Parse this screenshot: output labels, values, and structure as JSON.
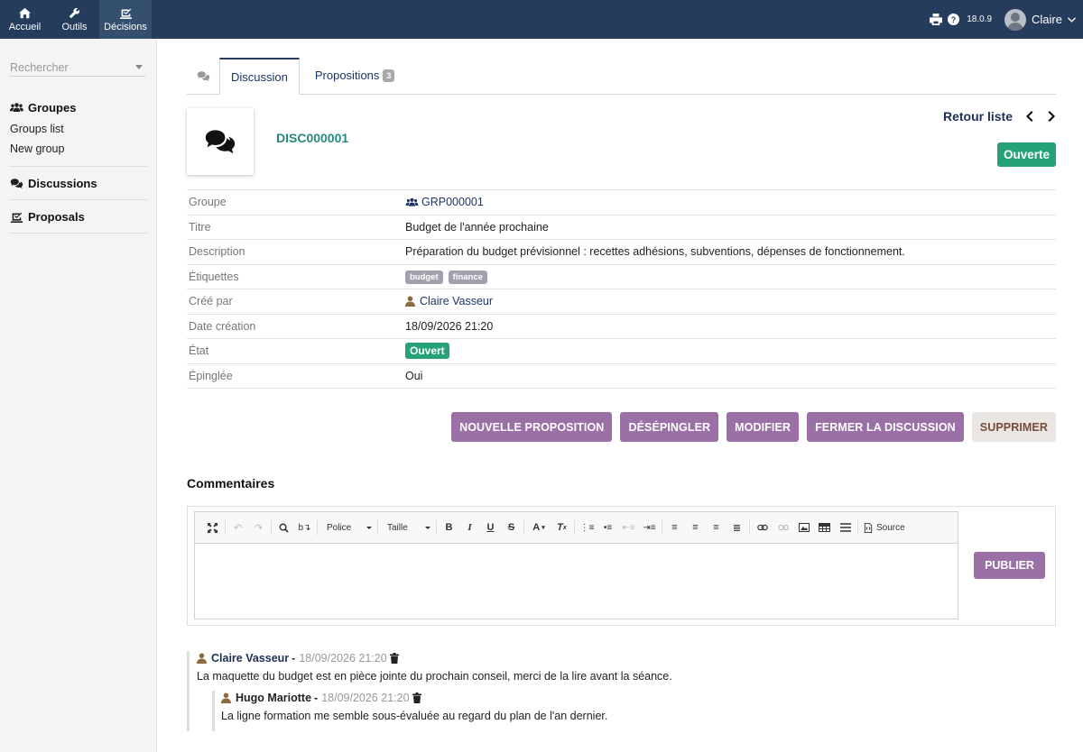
{
  "topbar": {
    "nav": [
      {
        "label": "Accueil",
        "icon": "home-icon"
      },
      {
        "label": "Outils",
        "icon": "wrench-icon"
      },
      {
        "label": "Décisions",
        "icon": "decisions-icon"
      }
    ],
    "version": "18.0.9",
    "user_name": "Claire"
  },
  "sidebar": {
    "search_placeholder": "Rechercher",
    "groups_heading": "Groupes",
    "groups_items": [
      "Groups list",
      "New group"
    ],
    "discussions_heading": "Discussions",
    "proposals_heading": "Proposals"
  },
  "tabs": {
    "discussion_label": "Discussion",
    "propositions_label": "Propositions",
    "propositions_count": "3"
  },
  "record": {
    "ref": "DISC000001",
    "back_label": "Retour liste",
    "status_button": "Ouverte"
  },
  "fields": {
    "groupe_label": "Groupe",
    "groupe_value": "GRP000001",
    "titre_label": "Titre",
    "titre_value": "Budget de l'année prochaine",
    "description_label": "Description",
    "description_value": "Préparation du budget prévisionnel : recettes adhésions, subventions, dépenses de fonctionnement.",
    "etiquettes_label": "Étiquettes",
    "tags": [
      "budget",
      "finance"
    ],
    "cree_par_label": "Créé par",
    "cree_par_value": "Claire Vasseur",
    "date_label": "Date création",
    "date_value": "18/09/2026 21:20",
    "etat_label": "État",
    "etat_value": "Ouvert",
    "epinglee_label": "Épinglée",
    "epinglee_value": "Oui"
  },
  "actions": {
    "new_proposal": "NOUVELLE PROPOSITION",
    "unpin": "DÉSÉPINGLER",
    "edit": "MODIFIER",
    "close": "FERMER LA DISCUSSION",
    "delete": "SUPPRIMER"
  },
  "comments_section": {
    "title": "Commentaires",
    "toolbar": {
      "font": "Police",
      "size": "Taille",
      "source": "Source"
    },
    "publish": "PUBLIER",
    "items": [
      {
        "author": "Claire Vasseur",
        "date": "18/09/2026 21:20",
        "text": "La maquette du budget est en pièce jointe du prochain conseil, merci de la lire avant la séance.",
        "reply": {
          "author": "Hugo Mariotte",
          "date": "18/09/2026 21:20",
          "text": "La ligne formation me semble sous-évaluée au regard du plan de l'an dernier."
        }
      }
    ]
  },
  "colors": {
    "topbar": "#263c5c",
    "accent_purple": "#9a70a7",
    "status_green": "#25a27a",
    "ref_teal": "#26897b"
  }
}
